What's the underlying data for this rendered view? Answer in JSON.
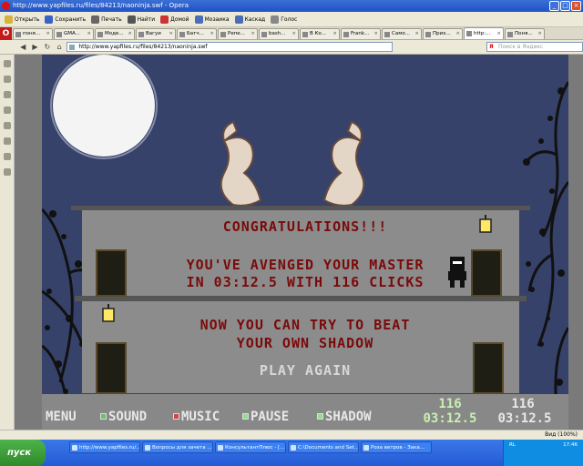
{
  "window": {
    "title": "http://www.yapfiles.ru/files/84213/naoninja.swf - Opera"
  },
  "toolbar": [
    {
      "label": "Открыть",
      "icon": "folder-icon",
      "color": "#d8b33a"
    },
    {
      "label": "Сохранить",
      "icon": "save-icon",
      "color": "#3a62c4"
    },
    {
      "label": "Печать",
      "icon": "print-icon",
      "color": "#666"
    },
    {
      "label": "Найти",
      "icon": "search-icon",
      "color": "#555"
    },
    {
      "label": "Домой",
      "icon": "home-icon",
      "color": "#c33"
    },
    {
      "label": "Мозаика",
      "icon": "tile-icon",
      "color": "#4a6db8"
    },
    {
      "label": "Каскад",
      "icon": "cascade-icon",
      "color": "#4a6db8"
    },
    {
      "label": "Голос",
      "icon": "voice-icon",
      "color": "#888"
    }
  ],
  "tabs": [
    {
      "label": "поня..."
    },
    {
      "label": "GMA..."
    },
    {
      "label": "Моде..."
    },
    {
      "label": "Вагуи"
    },
    {
      "label": "Батч..."
    },
    {
      "label": "Репе..."
    },
    {
      "label": "bash..."
    },
    {
      "label": "В Ко..."
    },
    {
      "label": "Frank..."
    },
    {
      "label": "Само..."
    },
    {
      "label": "Прих..."
    },
    {
      "label": "http:..."
    },
    {
      "label": "Поня..."
    }
  ],
  "address": {
    "url": "http://www.yapfiles.ru/files/84213/naoninja.swf",
    "search_placeholder": "Поиск в Яндекс"
  },
  "game": {
    "congrats": "CONGRATULATIONS!!!",
    "avenged_line1": "YOU'VE AVENGED YOUR MASTER",
    "avenged_line2": "IN 03:12.5 WITH 116 CLICKS",
    "beat_line1": "NOW YOU CAN TRY TO BEAT",
    "beat_line2": "YOUR OWN SHADOW",
    "play_again": "PLAY AGAIN",
    "hud": {
      "menu": "MENU",
      "sound": "SOUND",
      "music": "MUSIC",
      "pause": "PAUSE",
      "shadow": "SHADOW",
      "player_clicks": "116",
      "player_time": "03:12.5",
      "shadow_clicks": "116",
      "shadow_time": "03:12.5"
    },
    "colors": {
      "sky": "#36426a",
      "text": "#7a0a0a",
      "wall": "#8c8c8c",
      "sound_sq": "#6abf6a",
      "music_sq": "#d04545",
      "pause_sq": "#8ee08e",
      "shadow_sq": "#8ee08e",
      "player_score": "#c8f0b0"
    }
  },
  "statusbar": {
    "zoom": "Вид (100%)"
  },
  "taskbar": {
    "start": "пуск",
    "tasks": [
      "http://www.yapfiles.ru/...",
      "Вопросы для зачета ...",
      "КонсультантПлюс - [...",
      "C:\\Documents and Set...",
      "Роза ветров - Зака..."
    ],
    "clock": "17:46",
    "lang": "RL"
  }
}
